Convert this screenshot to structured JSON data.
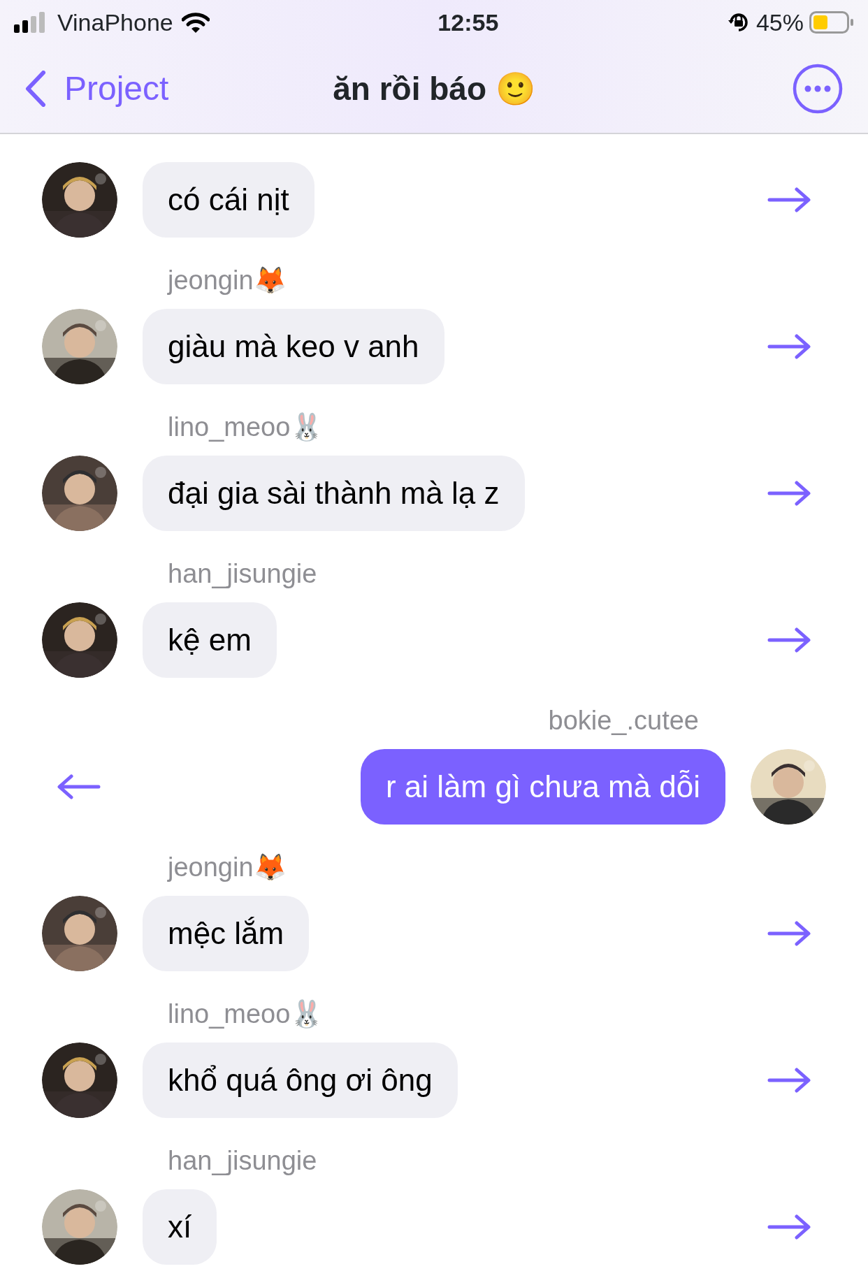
{
  "status_bar": {
    "carrier": "VinaPhone",
    "time": "12:55",
    "battery": "45%"
  },
  "nav": {
    "back": "Project",
    "title": "ăn rồi báo 🙂"
  },
  "messages": [
    {
      "kind": "incoming",
      "text": "có cái nịt"
    },
    {
      "kind": "incoming",
      "sender": "jeongin🦊",
      "text": "giàu mà keo v anh"
    },
    {
      "kind": "incoming",
      "sender": "lino_meoo🐰",
      "text": "đại gia sài thành mà lạ z"
    },
    {
      "kind": "incoming",
      "sender": "han_jisungie",
      "text": "kệ em"
    },
    {
      "kind": "outgoing",
      "sender": "bokie_.cutee",
      "text": "r ai làm gì chưa mà dỗi"
    },
    {
      "kind": "incoming",
      "sender": "jeongin🦊",
      "text": "mệc lắm"
    },
    {
      "kind": "incoming",
      "sender": "lino_meoo🐰",
      "text": "khổ quá ông ơi ông"
    },
    {
      "kind": "incoming",
      "sender": "han_jisungie",
      "text": "xí"
    }
  ]
}
